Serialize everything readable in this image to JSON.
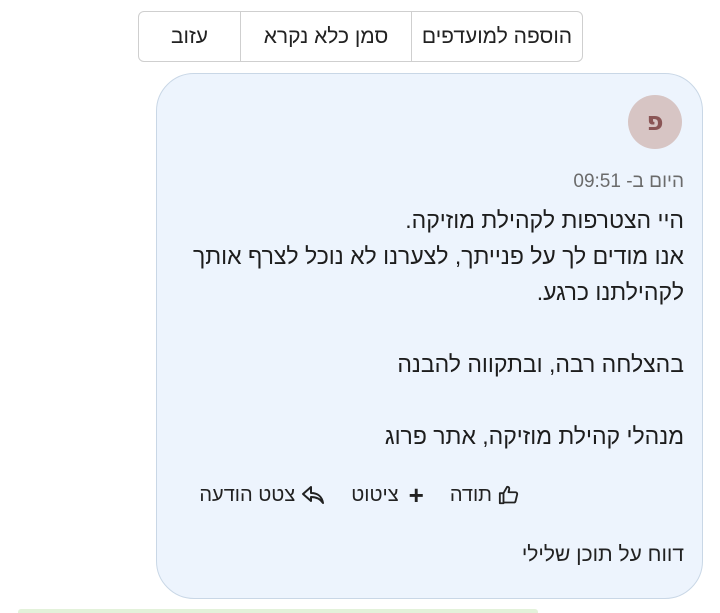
{
  "toolbar": {
    "add_favorites": "הוספה למועדפים",
    "mark_unread": "סמן כלא נקרא",
    "leave": "עזוב"
  },
  "message": {
    "avatar_letter": "פ",
    "timestamp": "היום ב- 09:51",
    "paragraphs": [
      "היי הצטרפות לקהילת מוזיקה.\nאנו מודים לך על פנייתך, לצערנו לא נוכל לצרף אותך לקהילתנו כרגע.",
      "בהצלחה רבה, ובתקווה להבנה",
      "מנהלי קהילת מוזיקה, אתר פרוג"
    ],
    "actions": {
      "thanks": "תודה",
      "quote": "ציטוט",
      "quote_message": "צטט הודעה"
    },
    "report": "דווח על תוכן שלילי"
  },
  "colors": {
    "card_bg": "#edf4fd",
    "avatar_bg": "#d7c5c4",
    "avatar_fg": "#8a5656"
  }
}
